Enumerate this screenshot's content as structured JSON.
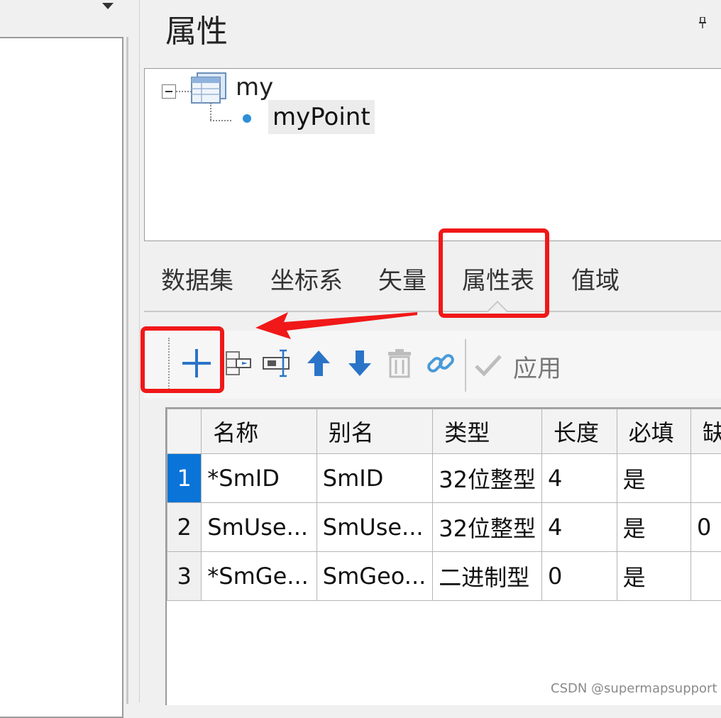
{
  "panel": {
    "title": "属性"
  },
  "tree": {
    "root_label": "my",
    "child_label": "myPoint"
  },
  "tabs": [
    {
      "label": "数据集"
    },
    {
      "label": "坐标系"
    },
    {
      "label": "矢量"
    },
    {
      "label": "属性表",
      "active": true
    },
    {
      "label": "值域"
    }
  ],
  "toolbar": {
    "buttons": [
      {
        "icon": "plus-icon",
        "tooltip": ""
      },
      {
        "icon": "insert-field-icon"
      },
      {
        "icon": "field-edit-icon"
      },
      {
        "icon": "arrow-up-icon"
      },
      {
        "icon": "arrow-down-icon"
      },
      {
        "icon": "trash-icon"
      },
      {
        "icon": "link-icon"
      }
    ],
    "apply_label": "应用"
  },
  "grid": {
    "columns": [
      "名称",
      "别名",
      "类型",
      "长度",
      "必填",
      "缺"
    ],
    "rows": [
      {
        "num": "1",
        "cells": [
          "*SmID",
          "SmID",
          "32位整型",
          "4",
          "是",
          ""
        ],
        "selected": true
      },
      {
        "num": "2",
        "cells": [
          "SmUse...",
          "SmUse...",
          "32位整型",
          "4",
          "是",
          "0"
        ]
      },
      {
        "num": "3",
        "cells": [
          "*SmGe...",
          "SmGeo...",
          "二进制型",
          "0",
          "是",
          ""
        ]
      }
    ]
  },
  "colors": {
    "accent": "#0a74d8",
    "annotation": "#f01818",
    "point": "#2e8fd8",
    "toolbar_blue": "#2a74c8"
  },
  "watermark": "CSDN @supermapsupport"
}
